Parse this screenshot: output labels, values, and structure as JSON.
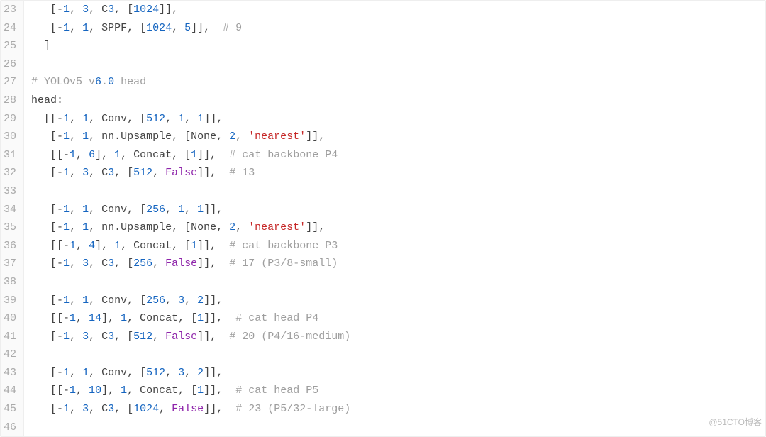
{
  "watermark": "@51CTO博客",
  "gutter": [
    "23",
    "24",
    "25",
    "26",
    "27",
    "28",
    "29",
    "30",
    "31",
    "32",
    "33",
    "34",
    "35",
    "36",
    "37",
    "38",
    "39",
    "40",
    "41",
    "42",
    "43",
    "44",
    "45",
    "46"
  ],
  "lines": [
    {
      "indent": "   ",
      "tokens": [
        [
          "pl",
          "[-"
        ],
        [
          "n",
          "1"
        ],
        [
          "pl",
          ", "
        ],
        [
          "n",
          "3"
        ],
        [
          "pl",
          ", C"
        ],
        [
          "n",
          "3"
        ],
        [
          "pl",
          ", ["
        ],
        [
          "n",
          "1024"
        ],
        [
          "pl",
          "]],"
        ]
      ]
    },
    {
      "indent": "   ",
      "tokens": [
        [
          "pl",
          "[-"
        ],
        [
          "n",
          "1"
        ],
        [
          "pl",
          ", "
        ],
        [
          "n",
          "1"
        ],
        [
          "pl",
          ", SPPF, ["
        ],
        [
          "n",
          "1024"
        ],
        [
          "pl",
          ", "
        ],
        [
          "n",
          "5"
        ],
        [
          "pl",
          "]],  "
        ],
        [
          "cm",
          "# 9"
        ]
      ]
    },
    {
      "indent": "  ",
      "tokens": [
        [
          "pl",
          "]"
        ]
      ]
    },
    {
      "indent": "",
      "tokens": []
    },
    {
      "indent": "",
      "tokens": [
        [
          "cm",
          "# YOLOv5 v"
        ],
        [
          "n",
          "6"
        ],
        [
          "cm",
          "."
        ],
        [
          "n",
          "0"
        ],
        [
          "cm",
          " head"
        ]
      ]
    },
    {
      "indent": "",
      "tokens": [
        [
          "pl",
          "head:"
        ]
      ]
    },
    {
      "indent": "  ",
      "tokens": [
        [
          "pl",
          "[[-"
        ],
        [
          "n",
          "1"
        ],
        [
          "pl",
          ", "
        ],
        [
          "n",
          "1"
        ],
        [
          "pl",
          ", Conv, ["
        ],
        [
          "n",
          "512"
        ],
        [
          "pl",
          ", "
        ],
        [
          "n",
          "1"
        ],
        [
          "pl",
          ", "
        ],
        [
          "n",
          "1"
        ],
        [
          "pl",
          "]],"
        ]
      ]
    },
    {
      "indent": "   ",
      "tokens": [
        [
          "pl",
          "[-"
        ],
        [
          "n",
          "1"
        ],
        [
          "pl",
          ", "
        ],
        [
          "n",
          "1"
        ],
        [
          "pl",
          ", nn.Upsample, [None, "
        ],
        [
          "n",
          "2"
        ],
        [
          "pl",
          ", "
        ],
        [
          "str",
          "'nearest'"
        ],
        [
          "pl",
          "]],"
        ]
      ]
    },
    {
      "indent": "   ",
      "tokens": [
        [
          "pl",
          "[[-"
        ],
        [
          "n",
          "1"
        ],
        [
          "pl",
          ", "
        ],
        [
          "n",
          "6"
        ],
        [
          "pl",
          "], "
        ],
        [
          "n",
          "1"
        ],
        [
          "pl",
          ", Concat, ["
        ],
        [
          "n",
          "1"
        ],
        [
          "pl",
          "]],  "
        ],
        [
          "cm",
          "# cat backbone P4"
        ]
      ]
    },
    {
      "indent": "   ",
      "tokens": [
        [
          "pl",
          "[-"
        ],
        [
          "n",
          "1"
        ],
        [
          "pl",
          ", "
        ],
        [
          "n",
          "3"
        ],
        [
          "pl",
          ", C"
        ],
        [
          "n",
          "3"
        ],
        [
          "pl",
          ", ["
        ],
        [
          "n",
          "512"
        ],
        [
          "pl",
          ", "
        ],
        [
          "bool",
          "False"
        ],
        [
          "pl",
          "]],  "
        ],
        [
          "cm",
          "# 13"
        ]
      ]
    },
    {
      "indent": "",
      "tokens": []
    },
    {
      "indent": "   ",
      "tokens": [
        [
          "pl",
          "[-"
        ],
        [
          "n",
          "1"
        ],
        [
          "pl",
          ", "
        ],
        [
          "n",
          "1"
        ],
        [
          "pl",
          ", Conv, ["
        ],
        [
          "n",
          "256"
        ],
        [
          "pl",
          ", "
        ],
        [
          "n",
          "1"
        ],
        [
          "pl",
          ", "
        ],
        [
          "n",
          "1"
        ],
        [
          "pl",
          "]],"
        ]
      ]
    },
    {
      "indent": "   ",
      "tokens": [
        [
          "pl",
          "[-"
        ],
        [
          "n",
          "1"
        ],
        [
          "pl",
          ", "
        ],
        [
          "n",
          "1"
        ],
        [
          "pl",
          ", nn.Upsample, [None, "
        ],
        [
          "n",
          "2"
        ],
        [
          "pl",
          ", "
        ],
        [
          "str",
          "'nearest'"
        ],
        [
          "pl",
          "]],"
        ]
      ]
    },
    {
      "indent": "   ",
      "tokens": [
        [
          "pl",
          "[[-"
        ],
        [
          "n",
          "1"
        ],
        [
          "pl",
          ", "
        ],
        [
          "n",
          "4"
        ],
        [
          "pl",
          "], "
        ],
        [
          "n",
          "1"
        ],
        [
          "pl",
          ", Concat, ["
        ],
        [
          "n",
          "1"
        ],
        [
          "pl",
          "]],  "
        ],
        [
          "cm",
          "# cat backbone P3"
        ]
      ]
    },
    {
      "indent": "   ",
      "tokens": [
        [
          "pl",
          "[-"
        ],
        [
          "n",
          "1"
        ],
        [
          "pl",
          ", "
        ],
        [
          "n",
          "3"
        ],
        [
          "pl",
          ", C"
        ],
        [
          "n",
          "3"
        ],
        [
          "pl",
          ", ["
        ],
        [
          "n",
          "256"
        ],
        [
          "pl",
          ", "
        ],
        [
          "bool",
          "False"
        ],
        [
          "pl",
          "]],  "
        ],
        [
          "cm",
          "# 17 (P3/8-small)"
        ]
      ]
    },
    {
      "indent": "",
      "tokens": []
    },
    {
      "indent": "   ",
      "tokens": [
        [
          "pl",
          "[-"
        ],
        [
          "n",
          "1"
        ],
        [
          "pl",
          ", "
        ],
        [
          "n",
          "1"
        ],
        [
          "pl",
          ", Conv, ["
        ],
        [
          "n",
          "256"
        ],
        [
          "pl",
          ", "
        ],
        [
          "n",
          "3"
        ],
        [
          "pl",
          ", "
        ],
        [
          "n",
          "2"
        ],
        [
          "pl",
          "]],"
        ]
      ]
    },
    {
      "indent": "   ",
      "tokens": [
        [
          "pl",
          "[[-"
        ],
        [
          "n",
          "1"
        ],
        [
          "pl",
          ", "
        ],
        [
          "n",
          "14"
        ],
        [
          "pl",
          "], "
        ],
        [
          "n",
          "1"
        ],
        [
          "pl",
          ", Concat, ["
        ],
        [
          "n",
          "1"
        ],
        [
          "pl",
          "]],  "
        ],
        [
          "cm",
          "# cat head P4"
        ]
      ]
    },
    {
      "indent": "   ",
      "tokens": [
        [
          "pl",
          "[-"
        ],
        [
          "n",
          "1"
        ],
        [
          "pl",
          ", "
        ],
        [
          "n",
          "3"
        ],
        [
          "pl",
          ", C"
        ],
        [
          "n",
          "3"
        ],
        [
          "pl",
          ", ["
        ],
        [
          "n",
          "512"
        ],
        [
          "pl",
          ", "
        ],
        [
          "bool",
          "False"
        ],
        [
          "pl",
          "]],  "
        ],
        [
          "cm",
          "# 20 (P4/16-medium)"
        ]
      ]
    },
    {
      "indent": "",
      "tokens": []
    },
    {
      "indent": "   ",
      "tokens": [
        [
          "pl",
          "[-"
        ],
        [
          "n",
          "1"
        ],
        [
          "pl",
          ", "
        ],
        [
          "n",
          "1"
        ],
        [
          "pl",
          ", Conv, ["
        ],
        [
          "n",
          "512"
        ],
        [
          "pl",
          ", "
        ],
        [
          "n",
          "3"
        ],
        [
          "pl",
          ", "
        ],
        [
          "n",
          "2"
        ],
        [
          "pl",
          "]],"
        ]
      ]
    },
    {
      "indent": "   ",
      "tokens": [
        [
          "pl",
          "[[-"
        ],
        [
          "n",
          "1"
        ],
        [
          "pl",
          ", "
        ],
        [
          "n",
          "10"
        ],
        [
          "pl",
          "], "
        ],
        [
          "n",
          "1"
        ],
        [
          "pl",
          ", Concat, ["
        ],
        [
          "n",
          "1"
        ],
        [
          "pl",
          "]],  "
        ],
        [
          "cm",
          "# cat head P5"
        ]
      ]
    },
    {
      "indent": "   ",
      "tokens": [
        [
          "pl",
          "[-"
        ],
        [
          "n",
          "1"
        ],
        [
          "pl",
          ", "
        ],
        [
          "n",
          "3"
        ],
        [
          "pl",
          ", C"
        ],
        [
          "n",
          "3"
        ],
        [
          "pl",
          ", ["
        ],
        [
          "n",
          "1024"
        ],
        [
          "pl",
          ", "
        ],
        [
          "bool",
          "False"
        ],
        [
          "pl",
          "]],  "
        ],
        [
          "cm",
          "# 23 (P5/32-large)"
        ]
      ]
    },
    {
      "indent": "",
      "tokens": []
    }
  ]
}
